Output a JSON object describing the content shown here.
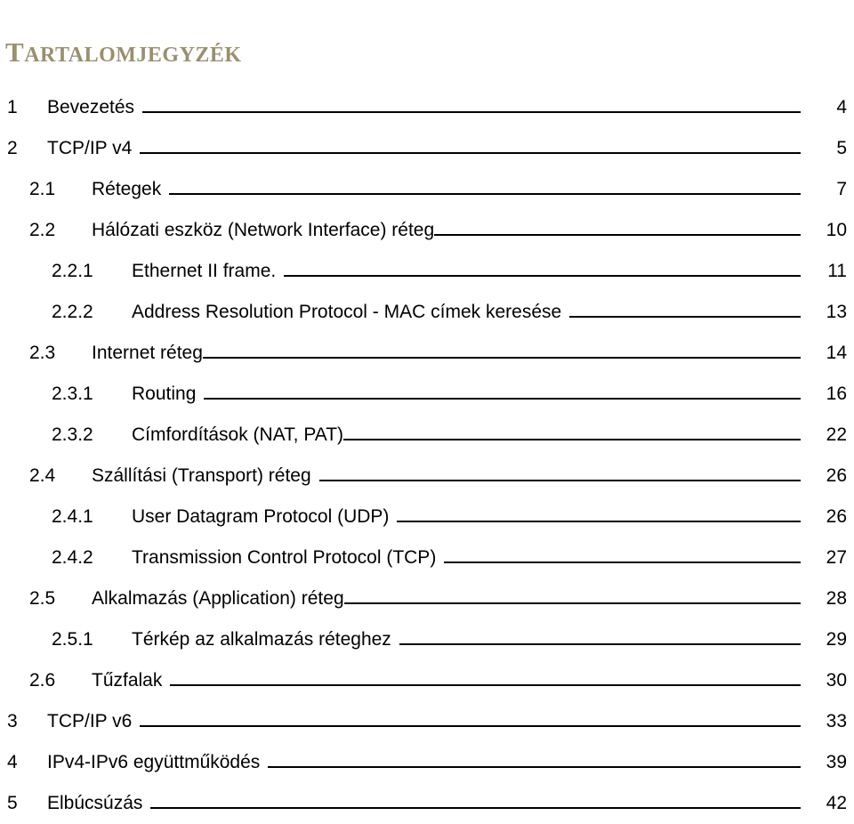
{
  "document": {
    "title": "Tartalomjegyzék",
    "title_display": "TARTALOMJEGYZÉK",
    "title_color": "#9a8f6e",
    "background_color": "#ffffff",
    "text_color": "#000000",
    "language": "hu"
  },
  "toc": {
    "entries": [
      {
        "number": "1",
        "label": "Bevezetés",
        "page": "4",
        "level": 1,
        "gap": true
      },
      {
        "number": "2",
        "label": "TCP/IP v4",
        "page": "5",
        "level": 1,
        "gap": true
      },
      {
        "number": "2.1",
        "label": "Rétegek",
        "page": "7",
        "level": 2,
        "gap": true
      },
      {
        "number": "2.2",
        "label": "Hálózati eszköz (Network Interface) réteg",
        "page": "10",
        "level": 2,
        "gap": false
      },
      {
        "number": "2.2.1",
        "label": "Ethernet II frame.",
        "page": "11",
        "level": 3,
        "gap": true
      },
      {
        "number": "2.2.2",
        "label": "Address Resolution Protocol - MAC címek keresése",
        "page": "13",
        "level": 3,
        "gap": true
      },
      {
        "number": "2.3",
        "label": "Internet réteg",
        "page": "14",
        "level": 2,
        "gap": false
      },
      {
        "number": "2.3.1",
        "label": "Routing",
        "page": "16",
        "level": 3,
        "gap": true
      },
      {
        "number": "2.3.2",
        "label": "Címfordítások (NAT, PAT)",
        "page": "22",
        "level": 3,
        "gap": false
      },
      {
        "number": "2.4",
        "label": "Szállítási (Transport) réteg",
        "page": "26",
        "level": 2,
        "gap": true
      },
      {
        "number": "2.4.1",
        "label": "User Datagram Protocol (UDP)",
        "page": "26",
        "level": 3,
        "gap": true
      },
      {
        "number": "2.4.2",
        "label": "Transmission Control Protocol (TCP)",
        "page": "27",
        "level": 3,
        "gap": true
      },
      {
        "number": "2.5",
        "label": "Alkalmazás (Application) réteg",
        "page": "28",
        "level": 2,
        "gap": false
      },
      {
        "number": "2.5.1",
        "label": "Térkép az alkalmazás réteghez",
        "page": "29",
        "level": 3,
        "gap": true
      },
      {
        "number": "2.6",
        "label": "Tűzfalak",
        "page": "30",
        "level": 2,
        "gap": true
      },
      {
        "number": "3",
        "label": "TCP/IP v6",
        "page": "33",
        "level": 1,
        "gap": true
      },
      {
        "number": "4",
        "label": "IPv4-IPv6 együttműködés",
        "page": "39",
        "level": 1,
        "gap": true
      },
      {
        "number": "5",
        "label": "Elbúcsúzás",
        "page": "42",
        "level": 1,
        "gap": true
      }
    ]
  }
}
